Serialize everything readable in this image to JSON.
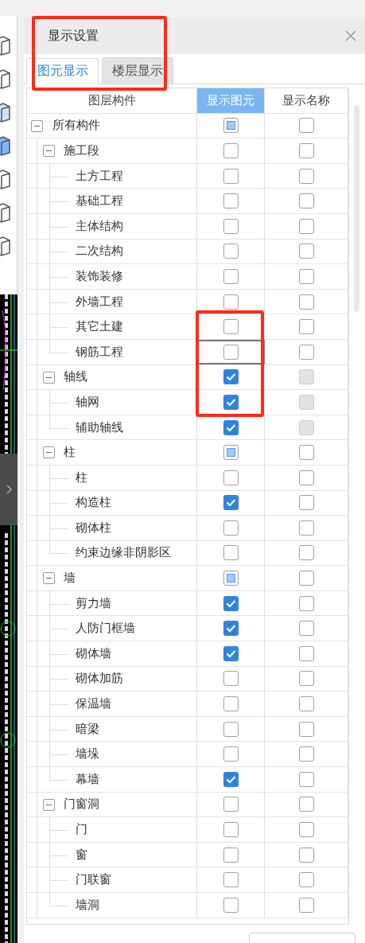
{
  "panel": {
    "title": "显示设置",
    "highlighted": true
  },
  "tabs": [
    {
      "label": "图元显示",
      "selected": true
    },
    {
      "label": "楼层显示",
      "selected": false
    }
  ],
  "table": {
    "columns": [
      {
        "label": "图层构件",
        "selected": false
      },
      {
        "label": "显示图元",
        "selected": true
      },
      {
        "label": "显示名称",
        "selected": false
      }
    ],
    "rows": [
      {
        "label": "所有构件",
        "expanded": true,
        "show_element": {
          "mixed": true
        },
        "show_name": {
          "checked": false
        },
        "children": [
          {
            "label": "施工段",
            "expanded": true,
            "show_element": {
              "checked": false
            },
            "show_name": {
              "checked": false
            },
            "children": [
              {
                "label": "土方工程",
                "show_element": {
                  "checked": false
                },
                "show_name": {
                  "checked": false
                }
              },
              {
                "label": "基础工程",
                "show_element": {
                  "checked": false
                },
                "show_name": {
                  "checked": false
                }
              },
              {
                "label": "主体结构",
                "show_element": {
                  "checked": false
                },
                "show_name": {
                  "checked": false
                }
              },
              {
                "label": "二次结构",
                "show_element": {
                  "checked": false
                },
                "show_name": {
                  "checked": false
                }
              },
              {
                "label": "装饰装修",
                "show_element": {
                  "checked": false
                },
                "show_name": {
                  "checked": false
                }
              },
              {
                "label": "外墙工程",
                "show_element": {
                  "checked": false
                },
                "show_name": {
                  "checked": false
                }
              },
              {
                "label": "其它土建",
                "highlighted": true,
                "show_element": {
                  "checked": false
                },
                "show_name": {
                  "checked": false
                }
              },
              {
                "label": "钢筋工程",
                "highlighted": true,
                "focused": true,
                "show_element": {
                  "checked": false
                },
                "show_name": {
                  "checked": false
                }
              }
            ]
          },
          {
            "label": "轴线",
            "expanded": true,
            "highlighted": true,
            "show_element": {
              "checked": true
            },
            "show_name": {
              "disabled": true
            },
            "children": [
              {
                "label": "轴网",
                "highlighted": true,
                "show_element": {
                  "checked": true
                },
                "show_name": {
                  "disabled": true
                }
              },
              {
                "label": "辅助轴线",
                "show_element": {
                  "checked": true
                },
                "show_name": {
                  "disabled": true
                }
              }
            ]
          },
          {
            "label": "柱",
            "expanded": true,
            "show_element": {
              "mixed": true
            },
            "show_name": {
              "checked": false
            },
            "children": [
              {
                "label": "柱",
                "show_element": {
                  "checked": false
                },
                "show_name": {
                  "checked": false
                }
              },
              {
                "label": "构造柱",
                "show_element": {
                  "checked": true
                },
                "show_name": {
                  "checked": false
                }
              },
              {
                "label": "砌体柱",
                "show_element": {
                  "checked": false
                },
                "show_name": {
                  "checked": false
                }
              },
              {
                "label": "约束边缘非阴影区",
                "show_element": {
                  "checked": false
                },
                "show_name": {
                  "checked": false
                }
              }
            ]
          },
          {
            "label": "墙",
            "expanded": true,
            "show_element": {
              "mixed": true
            },
            "show_name": {
              "checked": false
            },
            "children": [
              {
                "label": "剪力墙",
                "show_element": {
                  "checked": true
                },
                "show_name": {
                  "checked": false
                }
              },
              {
                "label": "人防门框墙",
                "show_element": {
                  "checked": true
                },
                "show_name": {
                  "checked": false
                }
              },
              {
                "label": "砌体墙",
                "show_element": {
                  "checked": true
                },
                "show_name": {
                  "checked": false
                }
              },
              {
                "label": "砌体加筋",
                "show_element": {
                  "checked": false
                },
                "show_name": {
                  "checked": false
                }
              },
              {
                "label": "保温墙",
                "show_element": {
                  "checked": false
                },
                "show_name": {
                  "checked": false
                }
              },
              {
                "label": "暗梁",
                "show_element": {
                  "checked": false
                },
                "show_name": {
                  "checked": false
                }
              },
              {
                "label": "墙垛",
                "show_element": {
                  "checked": false
                },
                "show_name": {
                  "checked": false
                }
              },
              {
                "label": "幕墙",
                "show_element": {
                  "checked": true
                },
                "show_name": {
                  "checked": false
                }
              }
            ]
          },
          {
            "label": "门窗洞",
            "expanded": true,
            "show_element": {
              "checked": false
            },
            "show_name": {
              "checked": false
            },
            "children": [
              {
                "label": "门",
                "show_element": {
                  "checked": false
                },
                "show_name": {
                  "checked": false
                }
              },
              {
                "label": "窗",
                "show_element": {
                  "checked": false
                },
                "show_name": {
                  "checked": false
                }
              },
              {
                "label": "门联窗",
                "show_element": {
                  "checked": false
                },
                "show_name": {
                  "checked": false
                }
              },
              {
                "label": "墙洞",
                "show_element": {
                  "checked": false
                },
                "show_name": {
                  "checked": false
                }
              }
            ]
          }
        ]
      }
    ]
  }
}
